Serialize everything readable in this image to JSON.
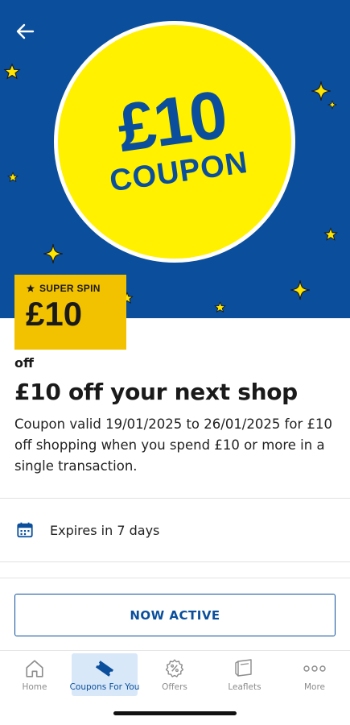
{
  "hero": {
    "circle_amount": "£10",
    "circle_label": "COUPON"
  },
  "badge": {
    "label": "SUPER SPIN",
    "amount": "£10"
  },
  "coupon": {
    "off_text": "off",
    "title": "£10 off your next shop",
    "description": "Coupon valid 19/01/2025 to 26/01/2025 for £10 off shopping when you spend £10 or more in a single transaction."
  },
  "expiry": {
    "text": "Expires in 7 days"
  },
  "action": {
    "button_label": "NOW ACTIVE"
  },
  "tabbar": {
    "items": [
      {
        "label": "Home",
        "icon": "home-icon"
      },
      {
        "label": "Coupons For You",
        "icon": "coupon-icon"
      },
      {
        "label": "Offers",
        "icon": "offers-icon"
      },
      {
        "label": "Leaflets",
        "icon": "leaflets-icon"
      },
      {
        "label": "More",
        "icon": "more-icon"
      }
    ],
    "active_index": 1
  },
  "colors": {
    "brand_blue": "#0b4f9c",
    "coupon_yellow": "#fff100",
    "badge_gold": "#f2c200"
  }
}
